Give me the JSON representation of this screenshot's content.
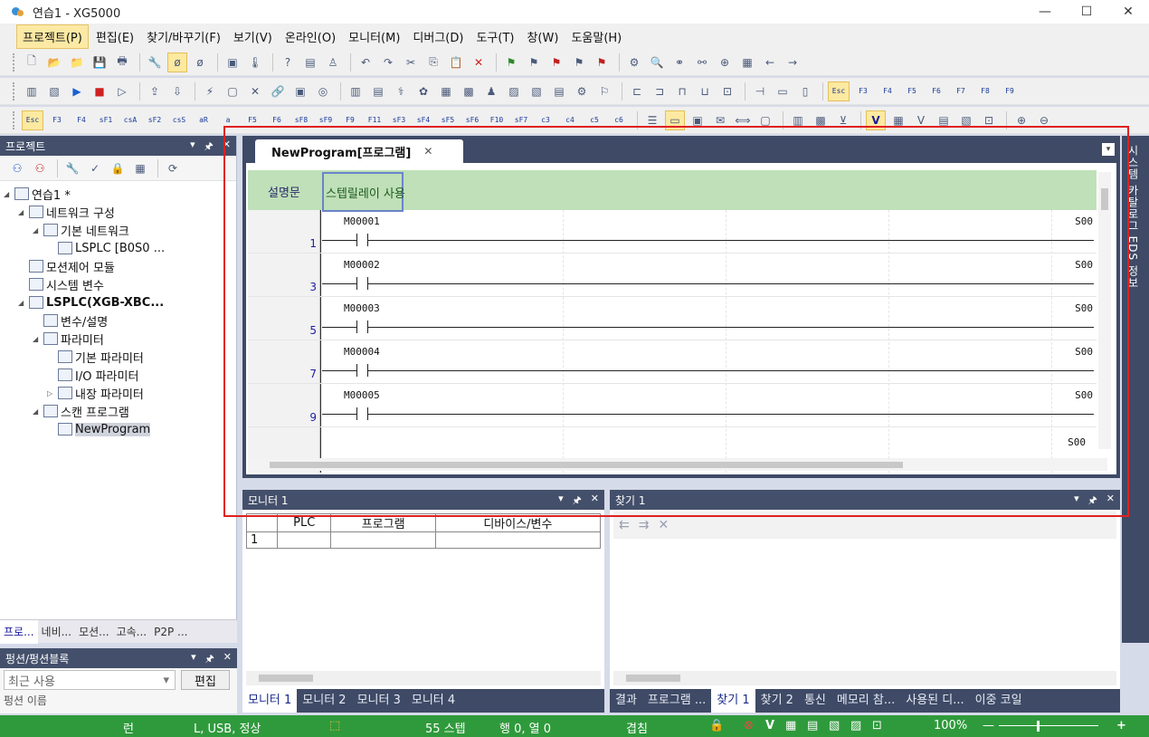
{
  "window": {
    "title": "연습1 - XG5000",
    "min": "—",
    "max": "☐",
    "close": "✕"
  },
  "menu": [
    "프로젝트(P)",
    "편집(E)",
    "찾기/바꾸기(F)",
    "보기(V)",
    "온라인(O)",
    "모니터(M)",
    "디버그(D)",
    "도구(T)",
    "창(W)",
    "도움말(H)"
  ],
  "project_panel": {
    "title": "프로젝트",
    "tree": [
      {
        "label": "연습1 *",
        "level": 0,
        "exp": "◢"
      },
      {
        "label": "네트워크 구성",
        "level": 1,
        "exp": "◢"
      },
      {
        "label": "기본 네트워크",
        "level": 2,
        "exp": "◢"
      },
      {
        "label": "LSPLC [B0S0 ...",
        "level": 3,
        "exp": ""
      },
      {
        "label": "모션제어 모듈",
        "level": 1,
        "exp": ""
      },
      {
        "label": "시스템 변수",
        "level": 1,
        "exp": ""
      },
      {
        "label": "LSPLC(XGB-XBC...",
        "level": 1,
        "exp": "◢",
        "bold": true
      },
      {
        "label": "변수/설명",
        "level": 2,
        "exp": ""
      },
      {
        "label": "파라미터",
        "level": 2,
        "exp": "◢"
      },
      {
        "label": "기본 파라미터",
        "level": 3,
        "exp": ""
      },
      {
        "label": "I/O 파라미터",
        "level": 3,
        "exp": ""
      },
      {
        "label": "내장 파라미터",
        "level": 3,
        "exp": "▷"
      },
      {
        "label": "스캔 프로그램",
        "level": 2,
        "exp": "◢"
      },
      {
        "label": "NewProgram",
        "level": 3,
        "exp": "",
        "selected": true
      }
    ],
    "tabs": [
      "프로...",
      "네비...",
      "모션...",
      "고속...",
      "P2P ..."
    ]
  },
  "function_panel": {
    "title": "펑션/펑션블록",
    "recent": "최근 사용",
    "edit": "편집",
    "cut_text": "펑션 이름"
  },
  "editor": {
    "tab_title": "NewProgram[프로그램]",
    "comment_label": "설명문",
    "comment_text": "스텝릴레이 사용",
    "rungs": [
      {
        "num": "1",
        "device": "M00001",
        "coil": "S00"
      },
      {
        "num": "3",
        "device": "M00002",
        "coil": "S00"
      },
      {
        "num": "5",
        "device": "M00003",
        "coil": "S00"
      },
      {
        "num": "7",
        "device": "M00004",
        "coil": "S00"
      },
      {
        "num": "9",
        "device": "M00005",
        "coil": "S00"
      }
    ],
    "extra_coil": "S00"
  },
  "right_strip": {
    "text": "시스템 카탈로그 EDS 정보"
  },
  "monitor": {
    "title": "모니터 1",
    "columns": [
      "PLC",
      "프로그램",
      "디바이스/변수"
    ],
    "row1": "1",
    "tabs": [
      "모니터 1",
      "모니터 2",
      "모니터 3",
      "모니터 4"
    ]
  },
  "find": {
    "title": "찾기 1",
    "tabs": [
      "결과",
      "프로그램 ...",
      "찾기 1",
      "찾기 2",
      "통신",
      "메모리 참...",
      "사용된 디...",
      "이중 코일"
    ]
  },
  "status": {
    "mode": "런",
    "conn": "L, USB, 정상",
    "steps": "55 스텝",
    "pos": "행 0, 열 0",
    "overwrite": "겹침",
    "zoom": "100%",
    "minus": "—",
    "plus": "+"
  }
}
